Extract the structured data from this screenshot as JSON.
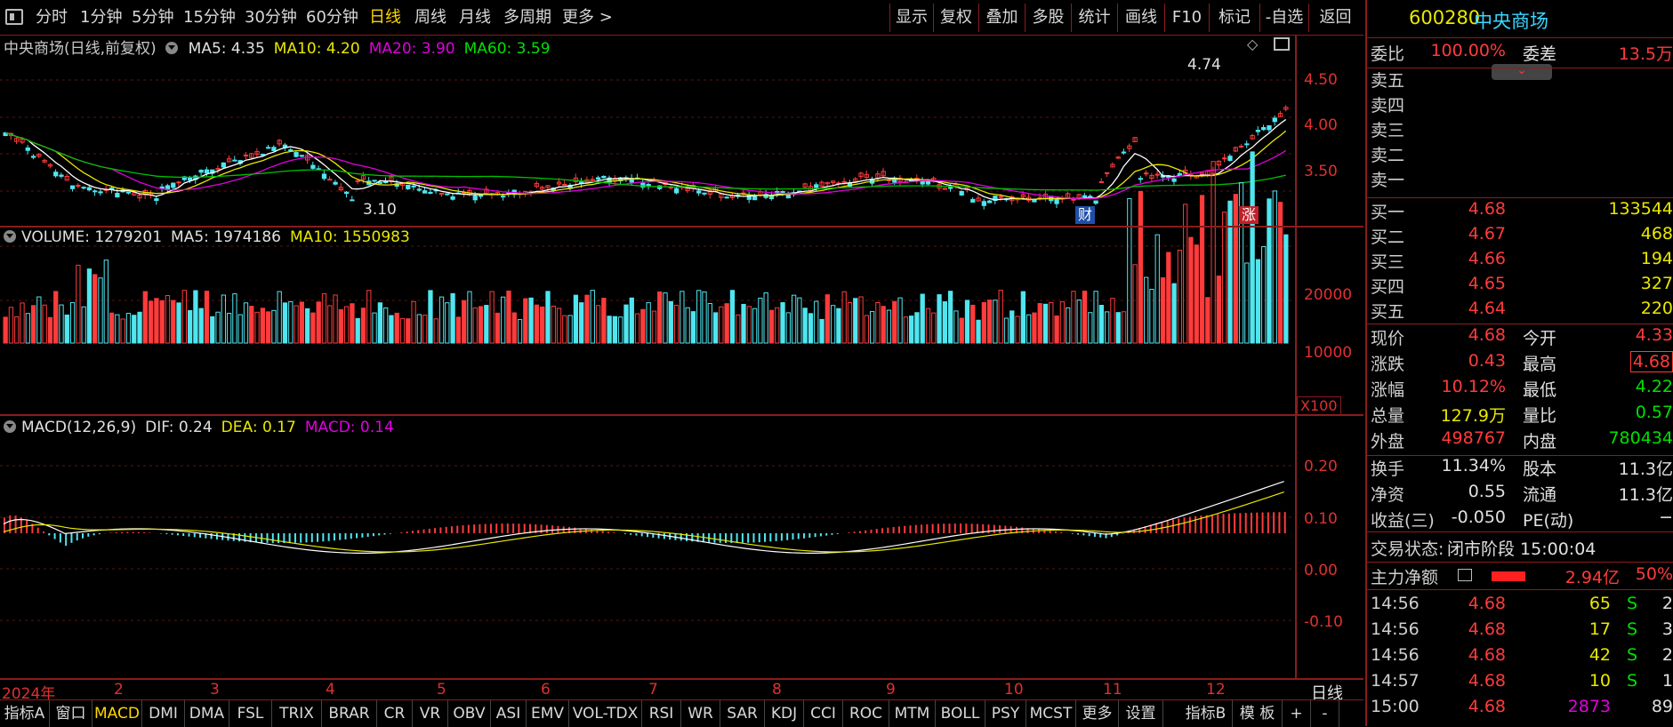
{
  "toolbar": {
    "periods": [
      "分时",
      "1分钟",
      "5分钟",
      "15分钟",
      "30分钟",
      "60分钟",
      "日线",
      "周线",
      "月线",
      "多周期",
      "更多 >"
    ],
    "active_period": "日线",
    "right_buttons": [
      "显示",
      "复权",
      "叠加",
      "多股",
      "统计",
      "画线",
      "F10",
      "标记",
      "-自选",
      "返回"
    ]
  },
  "kline": {
    "title": "中央商场(日线,前复权)",
    "ma5": "MA5: 4.35",
    "ma10": "MA10: 4.20",
    "ma20": "MA20: 3.90",
    "ma60": "MA60: 3.59",
    "yticks": [
      "4.50",
      "4.00",
      "3.50"
    ],
    "high_label": "4.74",
    "low_label": "3.10",
    "badges": [
      "财",
      "涨"
    ]
  },
  "volume": {
    "title": "VOLUME: 1279201",
    "ma5": "MA5: 1974186",
    "ma10": "MA10: 1550983",
    "yticks": [
      "20000",
      "10000"
    ],
    "unit": "X100"
  },
  "macd": {
    "title": "MACD(12,26,9)",
    "dif": "DIF: 0.24",
    "dea": "DEA: 0.17",
    "macd": "MACD: 0.14",
    "yticks": [
      "0.20",
      "0.10",
      "0.00",
      "-0.10"
    ]
  },
  "xaxis": {
    "labels": [
      "2024年",
      "2",
      "3",
      "4",
      "5",
      "6",
      "7",
      "8",
      "9",
      "10",
      "11",
      "12"
    ],
    "period_label": "日线"
  },
  "bottom_tabs": [
    "指标A",
    "窗口",
    "MACD",
    "DMI",
    "DMA",
    "FSL",
    "TRIX",
    "BRAR",
    "CR",
    "VR",
    "OBV",
    "ASI",
    "EMV",
    "VOL-TDX",
    "RSI",
    "WR",
    "SAR",
    "KDJ",
    "CCI",
    "ROC",
    "MTM",
    "BOLL",
    "PSY",
    "MCST",
    "更多",
    "设置",
    "指标B",
    "模 板",
    "+",
    "-"
  ],
  "active_tab": "MACD",
  "quote": {
    "code": "600280",
    "name": "中央商场",
    "weibi_label": "委比",
    "weibi": "100.00%",
    "weicha_label": "委差",
    "weicha": "13.5万",
    "sell": [
      {
        "label": "卖五",
        "price": "",
        "vol": ""
      },
      {
        "label": "卖四",
        "price": "",
        "vol": ""
      },
      {
        "label": "卖三",
        "price": "",
        "vol": ""
      },
      {
        "label": "卖二",
        "price": "",
        "vol": ""
      },
      {
        "label": "卖一",
        "price": "",
        "vol": ""
      }
    ],
    "buy": [
      {
        "label": "买一",
        "price": "4.68",
        "vol": "133544"
      },
      {
        "label": "买二",
        "price": "4.67",
        "vol": "468"
      },
      {
        "label": "买三",
        "price": "4.66",
        "vol": "194"
      },
      {
        "label": "买四",
        "price": "4.65",
        "vol": "327"
      },
      {
        "label": "买五",
        "price": "4.64",
        "vol": "220"
      }
    ],
    "stats": [
      {
        "l1": "现价",
        "v1": "4.68",
        "c1": "red",
        "l2": "今开",
        "v2": "4.33",
        "c2": "red"
      },
      {
        "l1": "涨跌",
        "v1": "0.43",
        "c1": "red",
        "l2": "最高",
        "v2": "4.68",
        "c2": "red"
      },
      {
        "l1": "涨幅",
        "v1": "10.12%",
        "c1": "red",
        "l2": "最低",
        "v2": "4.22",
        "c2": "green"
      },
      {
        "l1": "总量",
        "v1": "127.9万",
        "c1": "yellow",
        "l2": "量比",
        "v2": "0.57",
        "c2": "green"
      },
      {
        "l1": "外盘",
        "v1": "498767",
        "c1": "red",
        "l2": "内盘",
        "v2": "780434",
        "c2": "green"
      }
    ],
    "stats2": [
      {
        "l1": "换手",
        "v1": "11.34%",
        "c1": "white",
        "l2": "股本",
        "v2": "11.3亿",
        "c2": "white"
      },
      {
        "l1": "净资",
        "v1": "0.55",
        "c1": "white",
        "l2": "流通",
        "v2": "11.3亿",
        "c2": "white"
      },
      {
        "l1": "收益(三)",
        "v1": "-0.050",
        "c1": "white",
        "l2": "PE(动)",
        "v2": "−",
        "c2": "white"
      }
    ],
    "trade_status_label": "交易状态:",
    "trade_status": "闭市阶段 15:00:04",
    "main_flow_label": "主力净额",
    "main_flow": "2.94亿",
    "main_flow_pct": "50%",
    "ticks": [
      {
        "time": "14:56",
        "price": "4.68",
        "vol": "65",
        "side": "S",
        "n": "2"
      },
      {
        "time": "14:56",
        "price": "4.68",
        "vol": "17",
        "side": "S",
        "n": "3"
      },
      {
        "time": "14:56",
        "price": "4.68",
        "vol": "42",
        "side": "S",
        "n": "2"
      },
      {
        "time": "14:57",
        "price": "4.68",
        "vol": "10",
        "side": "S",
        "n": "1"
      },
      {
        "time": "15:00",
        "price": "4.68",
        "vol": "2873",
        "side": "",
        "n": "89"
      }
    ]
  },
  "colors": {
    "up": "#ff3b3b",
    "down": "#4fe6f0",
    "ma5": "#ffffff",
    "ma10": "#e8e800",
    "ma20": "#e000e0",
    "ma60": "#00c000",
    "grid": "#8b1c1c"
  }
}
